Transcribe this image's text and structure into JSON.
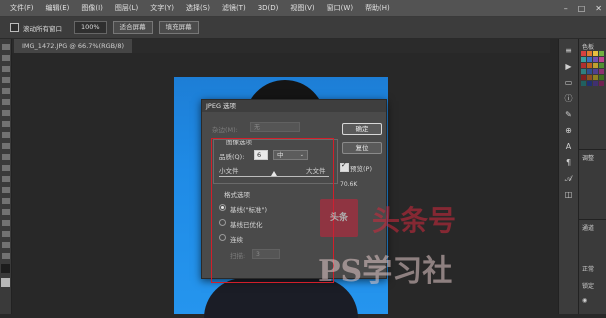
{
  "menubar": {
    "items": [
      "文件(F)",
      "编辑(E)",
      "图像(I)",
      "图层(L)",
      "文字(Y)",
      "选择(S)",
      "滤镜(T)",
      "3D(D)",
      "视图(V)",
      "窗口(W)",
      "帮助(H)"
    ],
    "window_controls": [
      "–",
      "□",
      "✕"
    ]
  },
  "options_bar": {
    "scroll_all_label": "滚动所有窗口",
    "zoom_value": "100%",
    "fit_screen_label": "适合屏幕",
    "fill_screen_label": "填充屏幕"
  },
  "document_tab": {
    "title": "IMG_1472.JPG @ 66.7%(RGB/8)"
  },
  "dialog": {
    "title": "JPEG 选项",
    "matte_label": "杂边(M):",
    "matte_value": "无",
    "ok_label": "确定",
    "reset_label": "复位",
    "image_options_label": "图像选项",
    "quality_label": "品质(Q):",
    "quality_value": "6",
    "quality_preset": "中",
    "small_file_label": "小文件",
    "large_file_label": "大文件",
    "quality_slider_fraction": 0.5,
    "preview_label": "预览(P)",
    "file_size": "70.6K",
    "format_options_label": "格式选项",
    "format_baseline_standard": "基线(\"标准\")",
    "format_baseline_optimized": "基线已优化",
    "format_progressive": "连续",
    "scans_label": "扫描:",
    "scans_value": "3"
  },
  "watermark": {
    "seal_text": "头条",
    "line1": "头条号",
    "line2": "PS学习社"
  },
  "right_panel": {
    "swatches_label": "色板",
    "adjust_label": "调整",
    "channels_label": "通道",
    "normal_label": "正常",
    "lock_label": "锁定"
  },
  "colors": {
    "highlight_border": "#d21f2a",
    "photo_background": "#1f8be6",
    "swatches": [
      "#d84040",
      "#e07a30",
      "#e8c040",
      "#70b040",
      "#3aa0a0",
      "#3a70c0",
      "#7050b0",
      "#c04090",
      "#b03030",
      "#c06020",
      "#c0a030",
      "#509030",
      "#308080",
      "#305090",
      "#504090",
      "#903070",
      "#802020",
      "#905020",
      "#908020",
      "#407020",
      "#206060",
      "#203070",
      "#403070",
      "#702050"
    ]
  }
}
